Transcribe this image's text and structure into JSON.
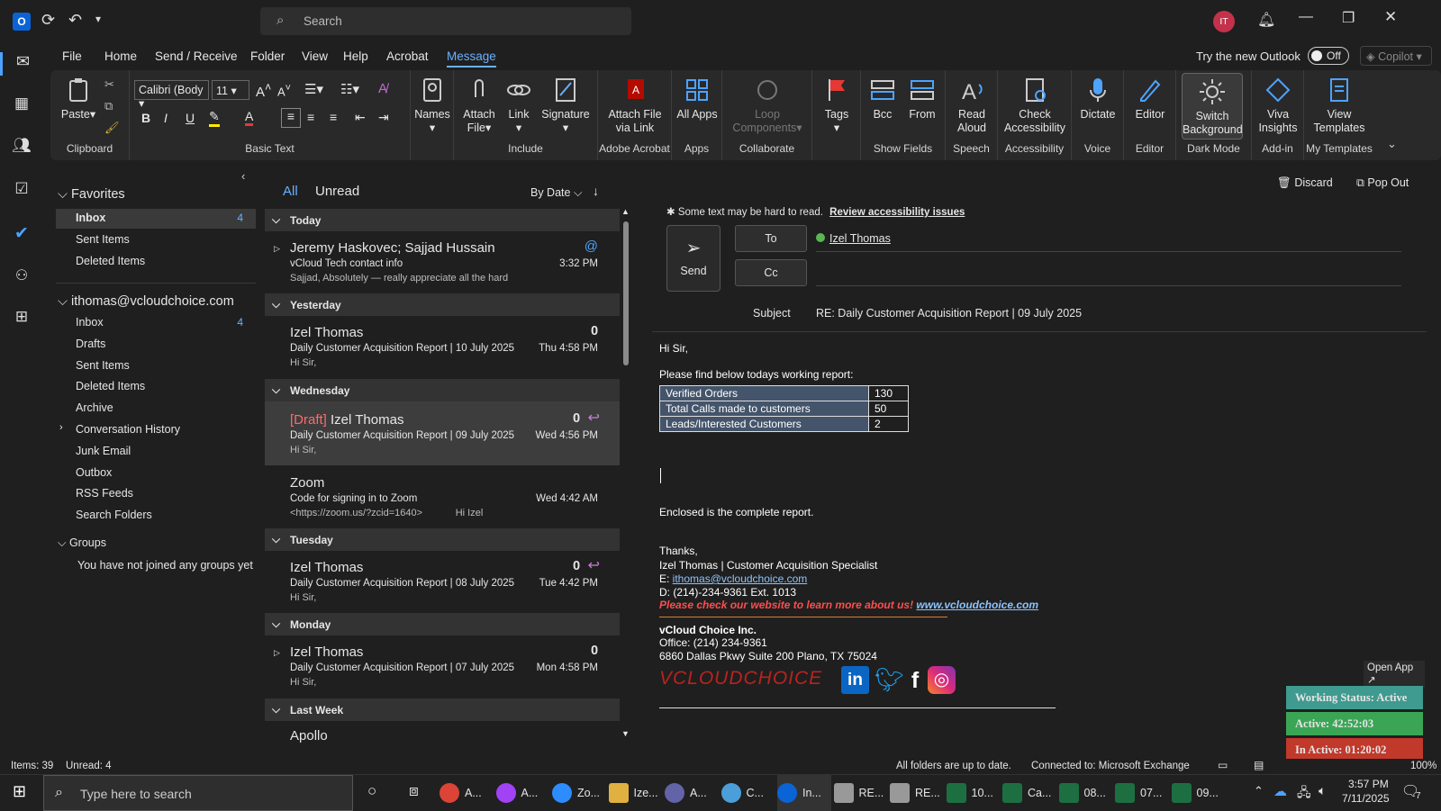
{
  "titlebar": {
    "search_placeholder": "Search",
    "avatar_initials": "IT"
  },
  "menu": {
    "items": [
      "File",
      "Home",
      "Send / Receive",
      "Folder",
      "View",
      "Help",
      "Acrobat",
      "Message"
    ],
    "active": "Message",
    "try_new": "Try the new Outlook",
    "toggle": "Off",
    "copilot": "Copilot"
  },
  "ribbon": {
    "clipboard": {
      "label": "Clipboard",
      "paste": "Paste"
    },
    "basic_text": {
      "label": "Basic Text",
      "font": "Calibri (Body",
      "size": "11"
    },
    "names": "Names",
    "include": {
      "label": "Include",
      "attach": "Attach File",
      "link": "Link",
      "signature": "Signature"
    },
    "adobe": {
      "label": "Adobe Acrobat",
      "attach_link": "Attach File via Link"
    },
    "apps": {
      "label": "Apps",
      "all": "All Apps"
    },
    "collab": {
      "label": "Collaborate",
      "loop": "Loop Components"
    },
    "tags": "Tags",
    "show_fields": {
      "label": "Show Fields",
      "bcc": "Bcc",
      "from": "From"
    },
    "speech": {
      "label": "Speech",
      "read": "Read Aloud"
    },
    "accessibility": {
      "label": "Accessibility",
      "check": "Check Accessibility"
    },
    "voice": {
      "label": "Voice",
      "dictate": "Dictate"
    },
    "editor": {
      "label": "Editor",
      "btn": "Editor"
    },
    "dark": {
      "label": "Dark Mode",
      "btn": "Switch Background"
    },
    "addin": {
      "label": "Add-in",
      "btn": "Viva Insights"
    },
    "templates": {
      "label": "My Templates",
      "btn": "View Templates"
    }
  },
  "folders": {
    "favorites_title": "Favorites",
    "favorites": [
      {
        "name": "Inbox",
        "count": "4"
      },
      {
        "name": "Sent Items",
        "count": ""
      },
      {
        "name": "Deleted Items",
        "count": ""
      }
    ],
    "account": "ithomas@vcloudchoice.com",
    "account_items": [
      {
        "name": "Inbox",
        "count": "4"
      },
      {
        "name": "Drafts",
        "count": ""
      },
      {
        "name": "Sent Items",
        "count": ""
      },
      {
        "name": "Deleted Items",
        "count": ""
      },
      {
        "name": "Archive",
        "count": ""
      },
      {
        "name": "Conversation History",
        "count": ""
      },
      {
        "name": "Junk Email",
        "count": ""
      },
      {
        "name": "Outbox",
        "count": ""
      },
      {
        "name": "RSS Feeds",
        "count": ""
      },
      {
        "name": "Search Folders",
        "count": ""
      }
    ],
    "groups_title": "Groups",
    "groups_note": "You have not joined any groups yet"
  },
  "list": {
    "tab_all": "All",
    "tab_unread": "Unread",
    "sort": "By Date",
    "groups": [
      "Today",
      "Yesterday",
      "Wednesday",
      "Tuesday",
      "Monday",
      "Last Week"
    ],
    "items": [
      {
        "sender": "Jeremy Haskovec;  Sajjad Hussain",
        "subject": "vCloud Tech contact info",
        "preview": "Sajjad,     Absolutely — really appreciate all the hard",
        "time": "3:32 PM"
      },
      {
        "sender": "Izel Thomas",
        "subject": "Daily Customer Acquisition Report | 10 July 2025",
        "preview": "Hi Sir,",
        "time": "Thu 4:58 PM"
      },
      {
        "draft": "[Draft]",
        "sender": "Izel Thomas",
        "subject": "Daily Customer Acquisition Report | 09 July 2025",
        "preview": "Hi Sir,",
        "time": "Wed 4:56 PM"
      },
      {
        "sender": "Zoom",
        "subject": "Code for signing in to Zoom",
        "preview": "<https://zoom.us/?zcid=1640>            Hi Izel",
        "time": "Wed 4:42 AM"
      },
      {
        "sender": "Izel Thomas",
        "subject": "Daily Customer Acquisition Report | 08 July 2025",
        "preview": "Hi Sir,",
        "time": "Tue 4:42 PM"
      },
      {
        "sender": "Izel Thomas",
        "subject": "Daily Customer Acquisition Report | 07 July 2025",
        "preview": "Hi Sir,",
        "time": "Mon 4:58 PM"
      },
      {
        "sender": "Apollo",
        "subject": "",
        "preview": "",
        "time": ""
      }
    ]
  },
  "reading": {
    "discard": "Discard",
    "popout": "Pop Out",
    "accessibility_note": "Some text may be hard to read.",
    "review": "Review accessibility issues",
    "send": "Send",
    "to": "To",
    "cc": "Cc",
    "to_value": "Izel Thomas",
    "subject_label": "Subject",
    "subject": "RE: Daily Customer Acquisition Report | 09 July 2025",
    "body": {
      "greeting": "Hi Sir,",
      "intro": "Please find below todays working report:",
      "table": [
        [
          "Verified Orders",
          "130"
        ],
        [
          "Total Calls made to customers",
          "50"
        ],
        [
          "Leads/Interested Customers",
          "2"
        ]
      ],
      "enclosed": "Enclosed is the complete report.",
      "thanks": "Thanks,",
      "sig_name": "Izel Thomas | Customer Acquisition Specialist",
      "sig_email_label": "E: ",
      "sig_email": "ithomas@vcloudchoice.com",
      "sig_phone": "D: (214)-234-9361 Ext. 1013",
      "promo": "Please check our website to learn more about us! ",
      "promo_link": "www.vcloudchoice.com",
      "company": "vCloud Choice Inc.",
      "office": "Office: (214) 234-9361",
      "address": "6860 Dallas Pkwy Suite 200 Plano, TX 75024",
      "logo": "VCLOUDCHOICE"
    }
  },
  "widget": {
    "open_app": "Open App",
    "status": "Working Status: Active",
    "active": "Active: 42:52:03",
    "inactive": "In Active: 01:20:02"
  },
  "status": {
    "items": "Items: 39",
    "unread": "Unread: 4",
    "sync": "All folders are up to date.",
    "connected": "Connected to: Microsoft Exchange",
    "zoom": "100%"
  },
  "taskbar": {
    "search": "Type here to search",
    "apps": [
      "A...",
      "A...",
      "Zo...",
      "Ize...",
      "A...",
      "C...",
      "In...",
      "RE...",
      "RE...",
      "10...",
      "Ca...",
      "08...",
      "07...",
      "09..."
    ],
    "time": "3:57 PM",
    "date": "7/11/2025",
    "notif": "7"
  },
  "colors": {
    "accent": "#4da3ff",
    "active_green": "#3aa655",
    "inactive_red": "#c0392b",
    "status_teal": "#3f9a8f"
  }
}
